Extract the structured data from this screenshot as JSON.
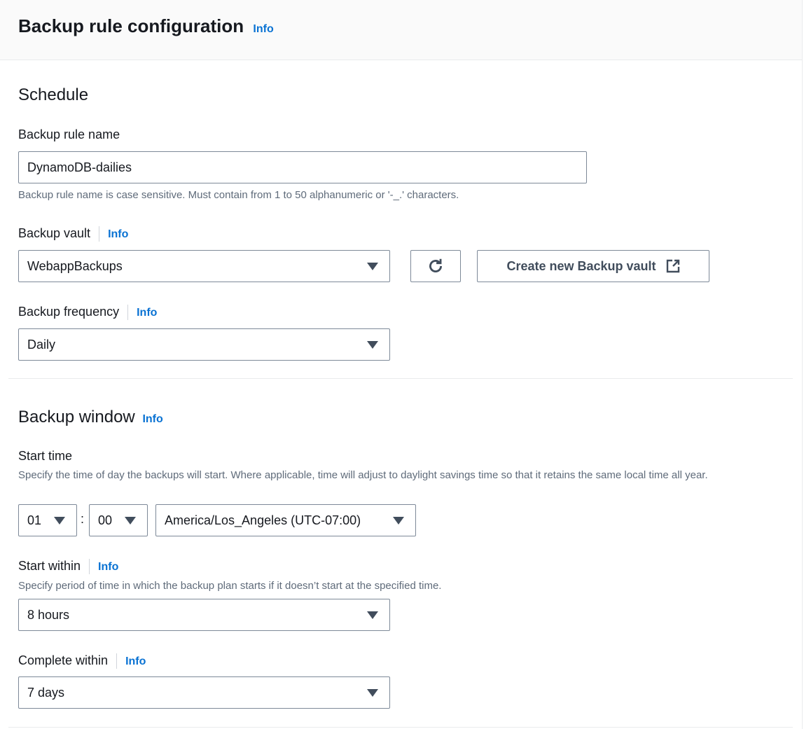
{
  "header": {
    "title": "Backup rule configuration",
    "info": "Info"
  },
  "schedule": {
    "heading": "Schedule",
    "rule_name": {
      "label": "Backup rule name",
      "value": "DynamoDB-dailies",
      "hint": "Backup rule name is case sensitive. Must contain from 1 to 50 alphanumeric or '-_.' characters."
    },
    "vault": {
      "label": "Backup vault",
      "info": "Info",
      "value": "WebappBackups",
      "refresh_icon": "refresh-icon",
      "create_label": "Create new Backup vault",
      "external_icon": "external-link-icon"
    },
    "frequency": {
      "label": "Backup frequency",
      "info": "Info",
      "value": "Daily"
    }
  },
  "window": {
    "heading": "Backup window",
    "info": "Info",
    "start_time": {
      "label": "Start time",
      "description": "Specify the time of day the backups will start. Where applicable, time will adjust to daylight savings time so that it retains the same local time all year.",
      "hour": "01",
      "colon": ":",
      "minute": "00",
      "timezone": "America/Los_Angeles (UTC-07:00)"
    },
    "start_within": {
      "label": "Start within",
      "info": "Info",
      "description": "Specify period of time in which the backup plan starts if it doesn’t start at the specified time.",
      "value": "8 hours"
    },
    "complete_within": {
      "label": "Complete within",
      "info": "Info",
      "value": "7 days"
    }
  }
}
